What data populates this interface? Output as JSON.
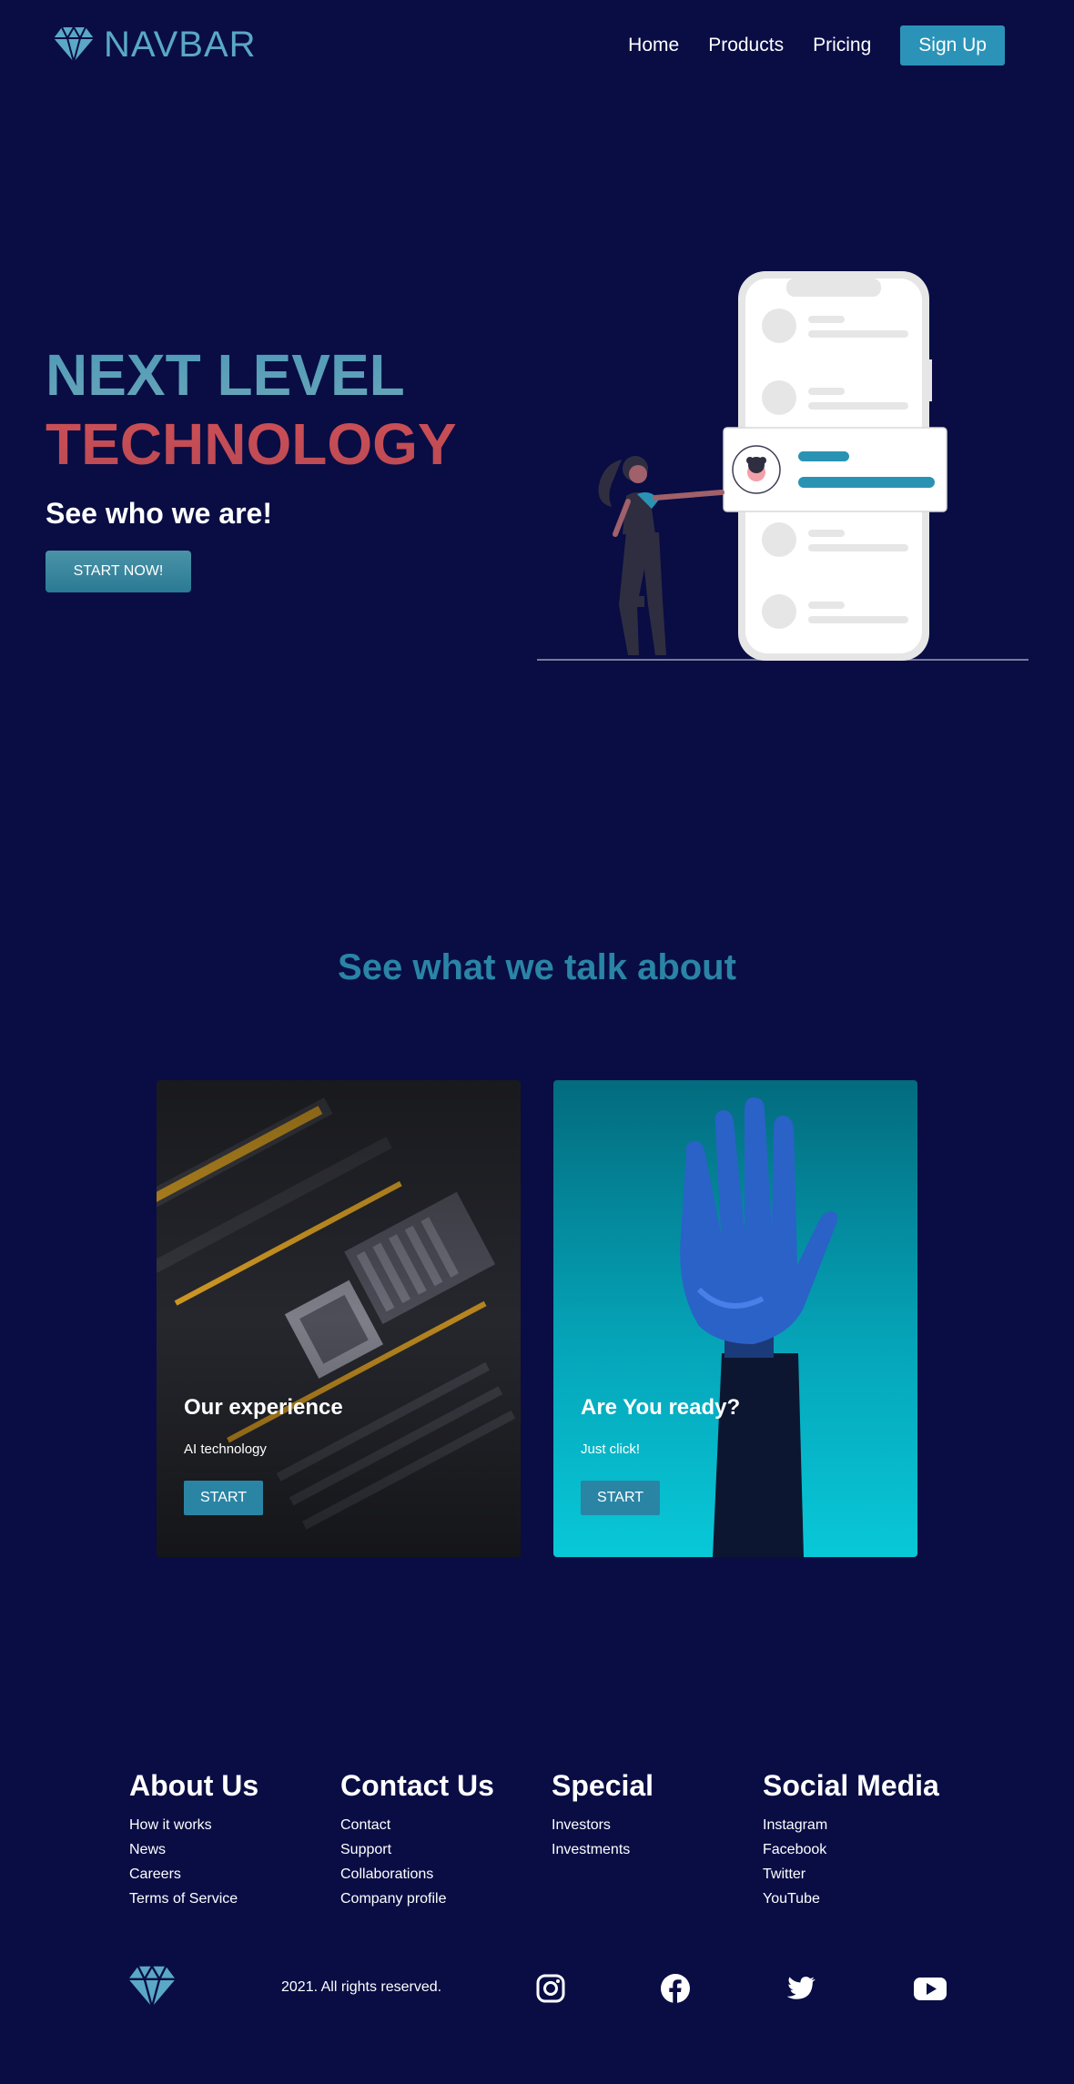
{
  "navbar": {
    "logo_text": "NAVBAR",
    "links": [
      "Home",
      "Products",
      "Pricing"
    ],
    "signup_label": "Sign Up"
  },
  "hero": {
    "line1": "NEXT LEVEL",
    "line2": "TECHNOLOGY",
    "subtitle": "See who we are!",
    "button_label": "START NOW!"
  },
  "section": {
    "title": "See what we talk about",
    "cards": [
      {
        "title": "Our experience",
        "subtitle": "AI technology",
        "button_label": "START"
      },
      {
        "title": "Are You ready?",
        "subtitle": "Just click!",
        "button_label": "START"
      }
    ]
  },
  "footer": {
    "columns": [
      {
        "heading": "About Us",
        "links": [
          "How it works",
          "News",
          "Careers",
          "Terms of Service"
        ]
      },
      {
        "heading": "Contact Us",
        "links": [
          "Contact",
          "Support",
          "Collaborations",
          "Company profile"
        ]
      },
      {
        "heading": "Special",
        "links": [
          "Investors",
          "Investments"
        ]
      },
      {
        "heading": "Social Media",
        "links": [
          "Instagram",
          "Facebook",
          "Twitter",
          "YouTube"
        ]
      }
    ],
    "copyright": "2021. All rights reserved.",
    "social_icons": [
      "instagram-icon",
      "facebook-icon",
      "twitter-icon",
      "youtube-icon"
    ]
  },
  "colors": {
    "background": "#090d44",
    "accent": "#2b93b8",
    "hero_blue": "#5a9fb8",
    "hero_red": "#c84d55"
  }
}
